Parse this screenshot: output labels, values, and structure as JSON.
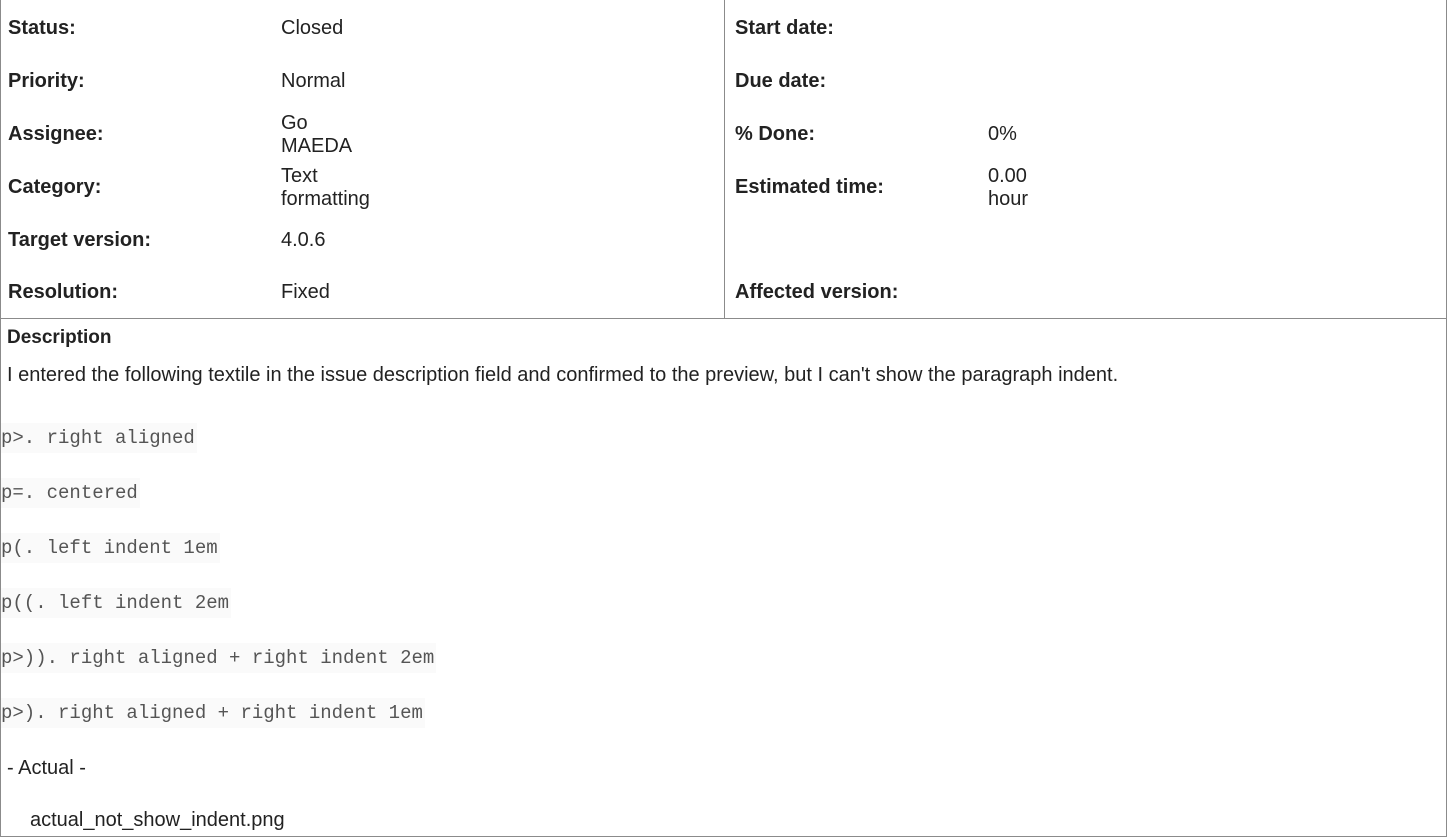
{
  "attributes": {
    "left": [
      {
        "label": "Status:",
        "value": "Closed"
      },
      {
        "label": "Priority:",
        "value": "Normal"
      },
      {
        "label": "Assignee:",
        "value": "Go MAEDA"
      },
      {
        "label": "Category:",
        "value": "Text formatting"
      },
      {
        "label": "Target version:",
        "value": "4.0.6"
      },
      {
        "label": "Resolution:",
        "value": "Fixed"
      }
    ],
    "right": [
      {
        "label": "Start date:",
        "value": ""
      },
      {
        "label": "Due date:",
        "value": ""
      },
      {
        "label": "% Done:",
        "value": "0%"
      },
      {
        "label": "Estimated time:",
        "value": "0.00 hour"
      },
      {
        "label": "",
        "value": ""
      },
      {
        "label": "Affected version:",
        "value": ""
      }
    ]
  },
  "description": {
    "title": "Description",
    "intro": "I entered the following textile in the issue description field and confirmed to the preview, but I can't show the paragraph indent.",
    "code_lines": [
      "p>. right aligned",
      "p=. centered",
      "p(. left indent 1em",
      "p((. left indent 2em",
      "p>)). right aligned + right indent 2em",
      "p>). right aligned + right indent 1em"
    ],
    "actual_label": "- Actual -",
    "attachment": "actual_not_show_indent.png"
  }
}
